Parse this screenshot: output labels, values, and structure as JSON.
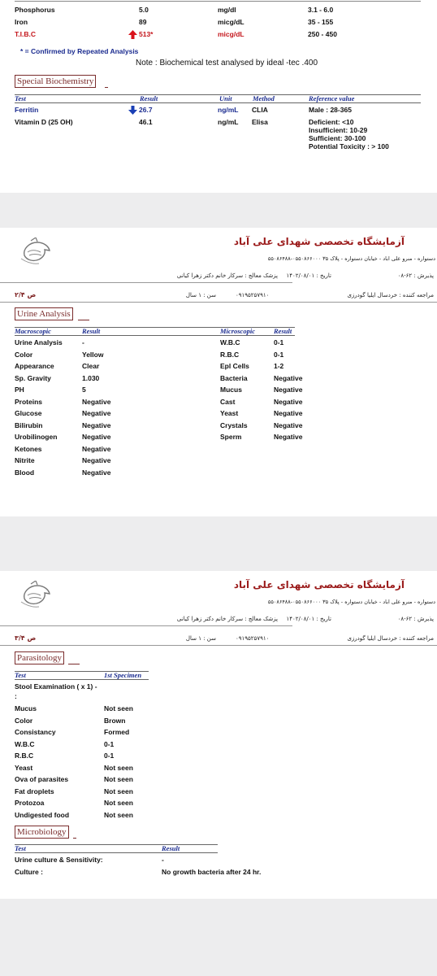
{
  "top": {
    "rows": [
      {
        "test": "Phosphorus",
        "result": "5.0",
        "unit": "mg/dl",
        "ref": "3.1 - 6.0"
      },
      {
        "test": "Iron",
        "result": "89",
        "unit": "micg/dL",
        "ref": "35 - 155"
      },
      {
        "test": "T.I.B.C",
        "result": "513*",
        "unit": "micg/dL",
        "ref": "250 - 450"
      }
    ],
    "confirmed_note": "* = Confirmed by Repeated Analysis",
    "note": "Note : Biochemical test analysed by ideal -tec .400"
  },
  "special": {
    "title": "Special Biochemistry",
    "headers": {
      "test": "Test",
      "result": "Result",
      "unit": "Unit",
      "method": "Method",
      "ref": "Reference value"
    },
    "ferritin": {
      "test": "Ferritin",
      "result": "26.7",
      "unit": "ng/mL",
      "method": "CLIA",
      "ref": "Male : 28-365"
    },
    "vitd": {
      "test": "Vitamin D (25 OH)",
      "result": "46.1",
      "unit": "ng/mL",
      "method": "Elisa",
      "ref": [
        "Deficient: <10",
        "Insufficient: 10-29",
        "Sufficient: 30-100",
        "Potential Toxicity : > 100"
      ]
    }
  },
  "lab_header": {
    "title": "آزمایشگاه تخصصی شهدای علی آباد",
    "address": "دستواره - منرو علی اباد - خیابان دستواره - پلاک ۳۵ ۰۵۵۰۸۶۶۰۰۰-۵۵۰۸۶۴۸۸",
    "reception": "پذیرش : ۶۲-۰۸",
    "date": "تاریخ : ۱۴۰۲/۰۸/۰۱",
    "doctor": "پزشک معالج : سرکار خانم دکتر زهرا کیانی",
    "patient": "مراجعه کننده : خردسال ایلیا گودرزی",
    "phone": "۰۹۱۹۵۲۵۷۹۱۰",
    "age": "سن : ۱ سال"
  },
  "urine": {
    "page_no": "ص ۲/۴",
    "title": "Urine Analysis",
    "headers": {
      "macro": "Macroscopic",
      "result": "Result",
      "micro": "Microscopic",
      "result2": "Result"
    },
    "macro": [
      {
        "name": "Urine Analysis",
        "value": "-"
      },
      {
        "name": "Color",
        "value": "Yellow"
      },
      {
        "name": "Appearance",
        "value": "Clear"
      },
      {
        "name": "Sp. Gravity",
        "value": "1.030"
      },
      {
        "name": "PH",
        "value": "5"
      },
      {
        "name": "Proteins",
        "value": "Negative"
      },
      {
        "name": "Glucose",
        "value": "Negative"
      },
      {
        "name": "Bilirubin",
        "value": "Negative"
      },
      {
        "name": "Urobilinogen",
        "value": "Negative"
      },
      {
        "name": "Ketones",
        "value": "Negative"
      },
      {
        "name": "Nitrite",
        "value": "Negative"
      },
      {
        "name": "Blood",
        "value": "Negative"
      }
    ],
    "micro": [
      {
        "name": "W.B.C",
        "value": "0-1"
      },
      {
        "name": "R.B.C",
        "value": "0-1"
      },
      {
        "name": "Epl Cells",
        "value": "1-2"
      },
      {
        "name": "Bacteria",
        "value": "Negative"
      },
      {
        "name": "Mucus",
        "value": "Negative"
      },
      {
        "name": "Cast",
        "value": "Negative"
      },
      {
        "name": "Yeast",
        "value": "Negative"
      },
      {
        "name": "Crystals",
        "value": "Negative"
      },
      {
        "name": "Sperm",
        "value": "Negative"
      }
    ]
  },
  "parasitology": {
    "page_no": "ص ۳/۴",
    "title": "Parasitology",
    "headers": {
      "test": "Test",
      "spec": "1st Specimen"
    },
    "exam": "Stool Examination ( x 1) -",
    "colon": ":",
    "rows": [
      {
        "name": "Mucus",
        "value": "Not seen"
      },
      {
        "name": "Color",
        "value": "Brown"
      },
      {
        "name": "Consistancy",
        "value": "Formed"
      },
      {
        "name": "W.B.C",
        "value": "0-1"
      },
      {
        "name": "R.B.C",
        "value": "0-1"
      },
      {
        "name": "Yeast",
        "value": "Not seen"
      },
      {
        "name": "Ova of parasites",
        "value": "Not seen"
      },
      {
        "name": "Fat droplets",
        "value": "Not seen"
      },
      {
        "name": "Protozoa",
        "value": "Not seen"
      },
      {
        "name": "Undigested food",
        "value": "Not seen"
      }
    ]
  },
  "microbiology": {
    "title": "Microbiology",
    "headers": {
      "test": "Test",
      "result": "Result"
    },
    "rows": [
      {
        "name": "Urine culture & Sensitivity:",
        "value": "-"
      },
      {
        "name": "Culture :",
        "value": "No growth bacteria after 24 hr."
      }
    ]
  },
  "colors": {
    "accent_red": "#c4161c",
    "header_blue": "#1a2b8f",
    "frame": "#7a2c2c"
  }
}
